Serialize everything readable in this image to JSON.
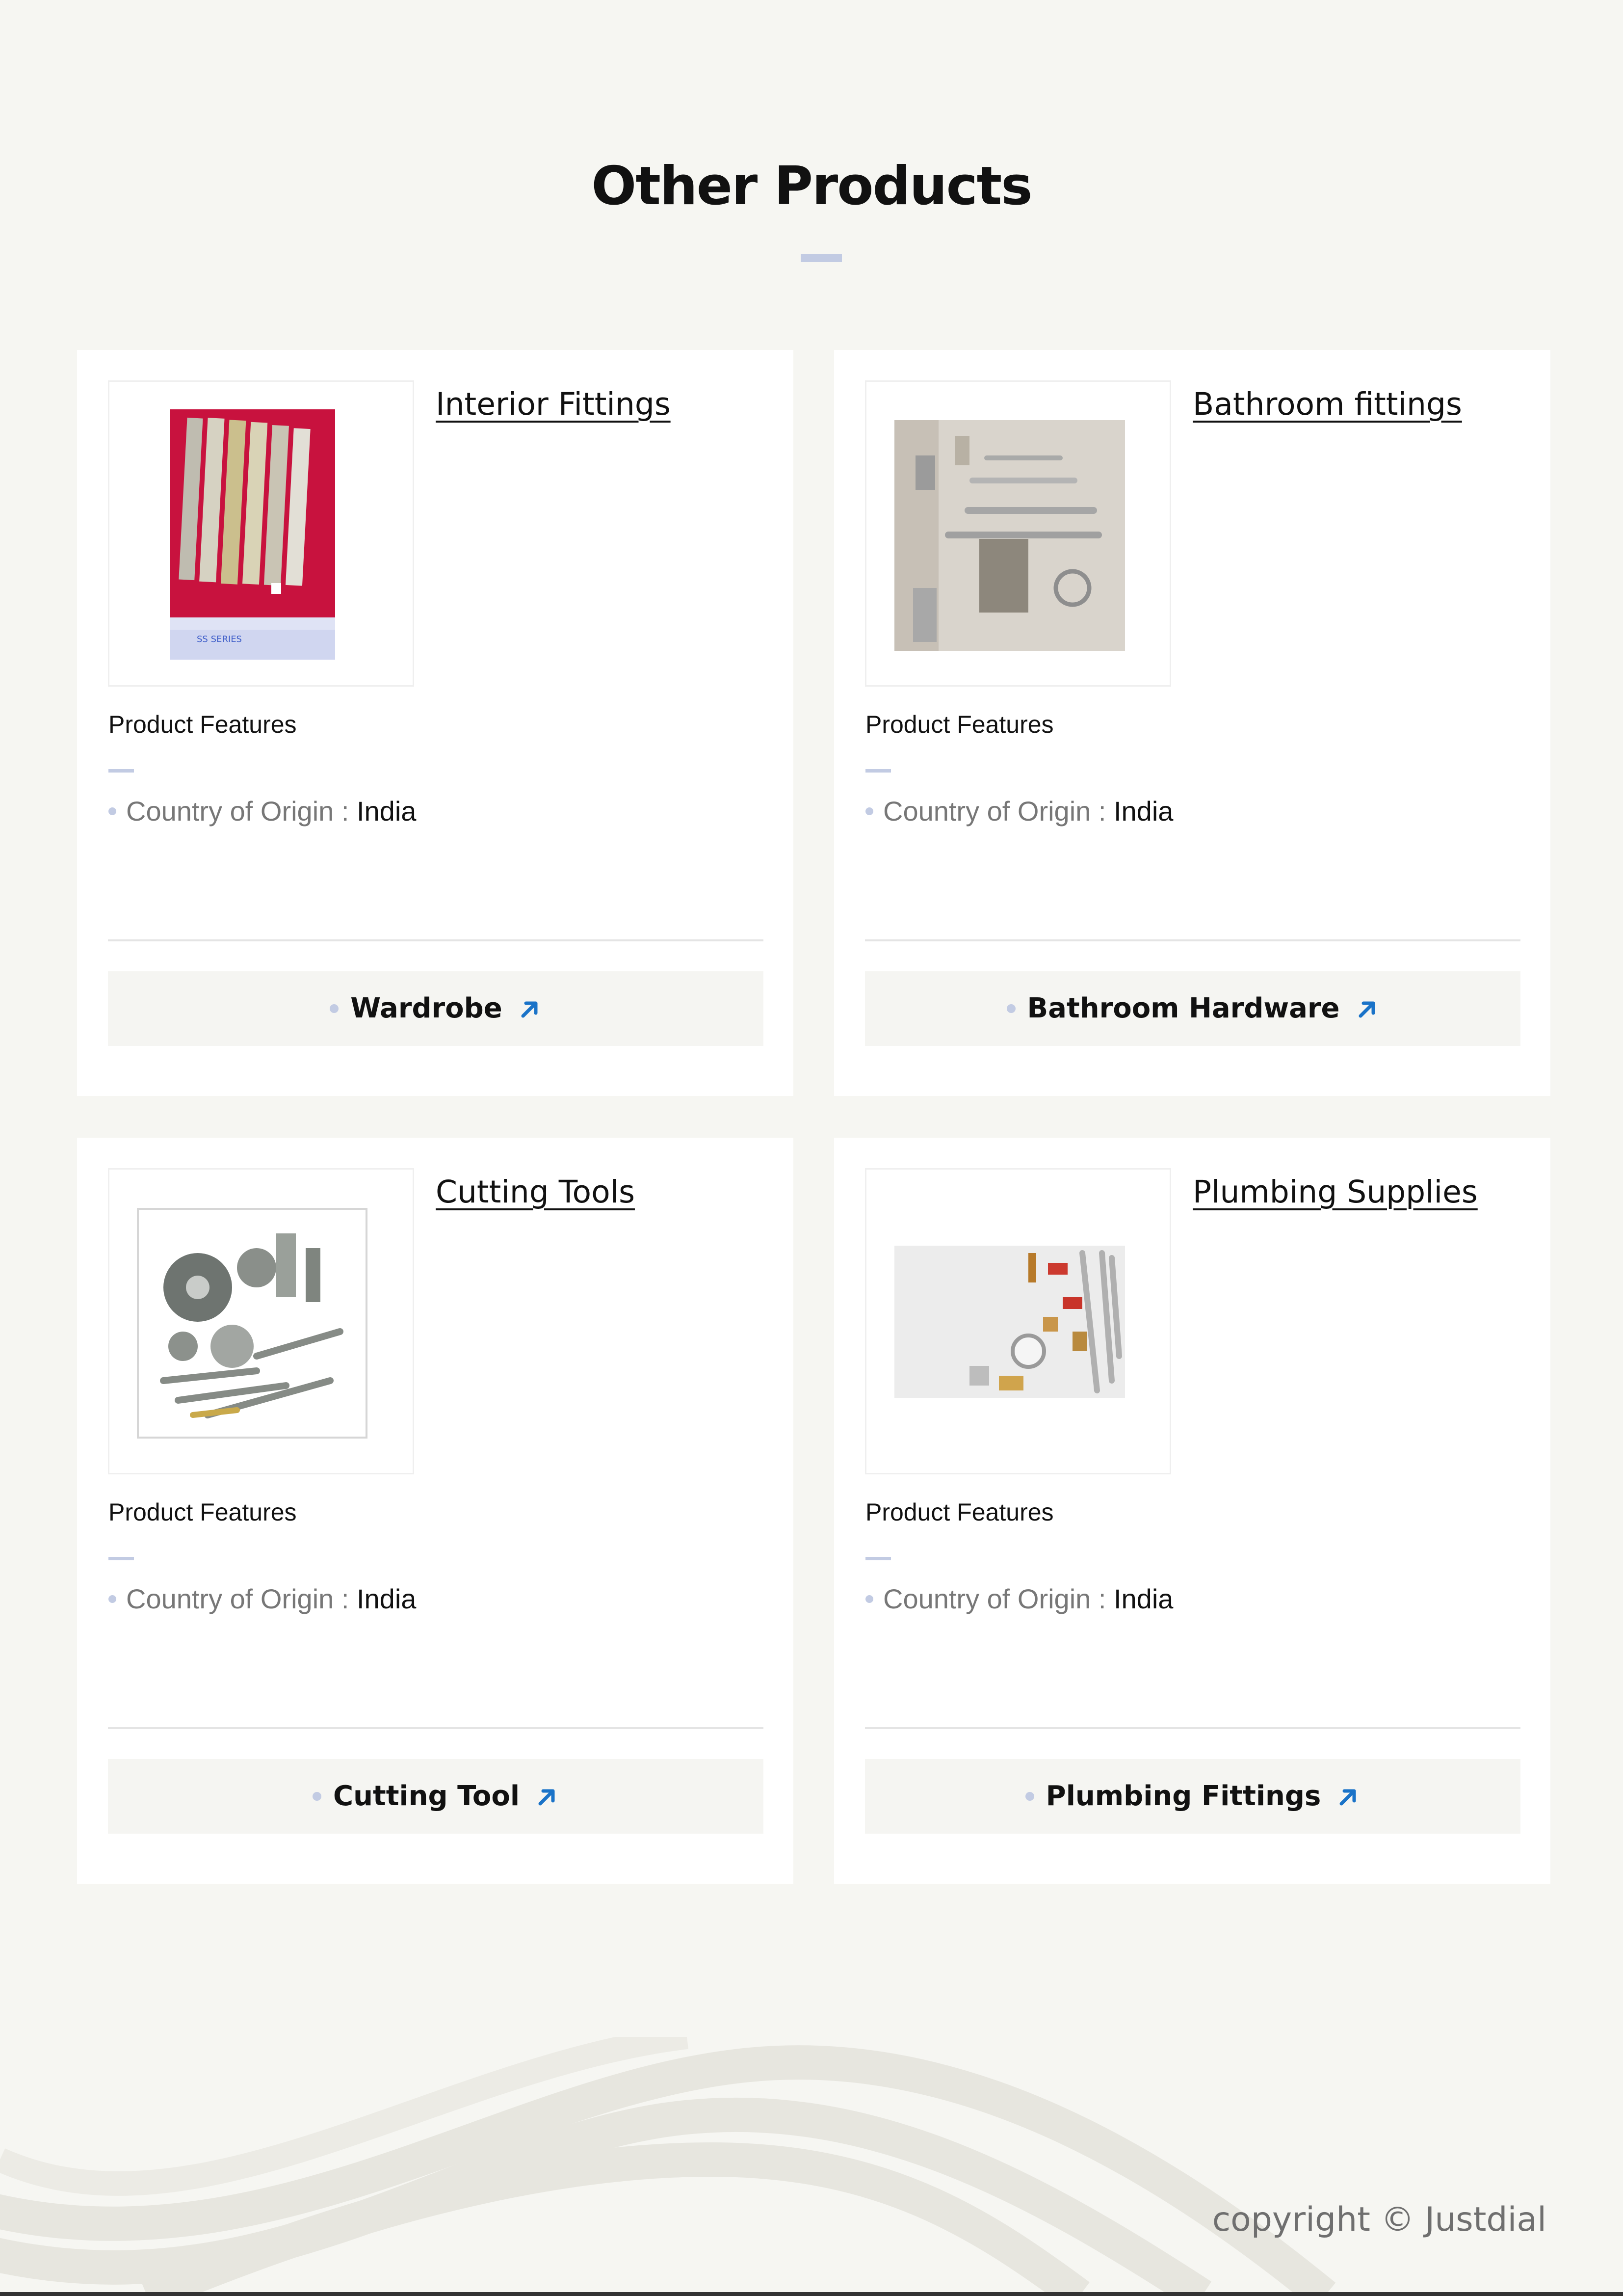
{
  "page": {
    "title": "Other Products",
    "copyright": "copyright © Justdial"
  },
  "products": [
    {
      "name": "Interior Fittings",
      "features_label": "Product Features",
      "spec_key": "Country of Origin",
      "spec_sep": " : ",
      "spec_value": "India",
      "category": "Wardrobe",
      "image": "aluminium-profile-packs-photo"
    },
    {
      "name": "Bathroom fittings",
      "features_label": "Product Features",
      "spec_key": "Country of Origin",
      "spec_sep": " : ",
      "spec_value": "India",
      "category": "Bathroom Hardware",
      "image": "bathroom-accessories-wall-photo"
    },
    {
      "name": "Cutting Tools",
      "features_label": "Product Features",
      "spec_key": "Country of Origin",
      "spec_sep": " : ",
      "spec_value": "India",
      "category": "Cutting Tool",
      "image": "milling-cutters-drills-photo"
    },
    {
      "name": "Plumbing Supplies",
      "features_label": "Product Features",
      "spec_key": "Country of Origin",
      "spec_sep": " : ",
      "spec_value": "India",
      "category": "Plumbing Fittings",
      "image": "brass-plumbing-fittings-photo"
    }
  ],
  "icons": {
    "category_link": "arrow-up-right-icon"
  },
  "colors": {
    "background": "#f6f6f2",
    "card": "#ffffff",
    "accent_dash": "#c2cbe3",
    "arrow": "#1a73c8",
    "button_bg": "#f5f5f2"
  }
}
